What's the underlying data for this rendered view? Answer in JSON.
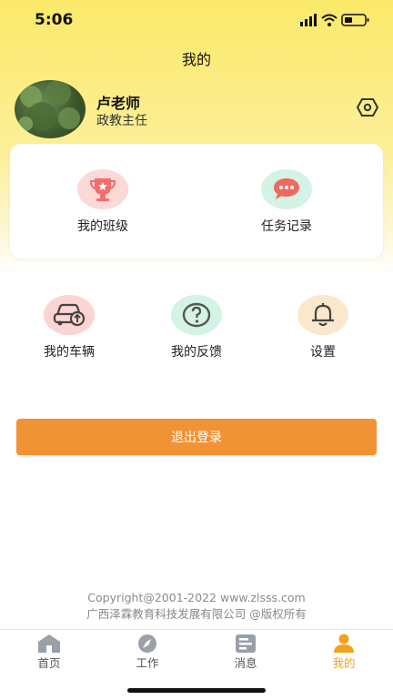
{
  "status_bar": {
    "time": "5:06"
  },
  "header": {
    "title": "我的"
  },
  "profile": {
    "name": "卢老师",
    "role": "政教主任"
  },
  "card": {
    "items": [
      {
        "label": "我的班级",
        "icon": "trophy-icon"
      },
      {
        "label": "任务记录",
        "icon": "chat-bubble-icon"
      }
    ]
  },
  "grid": {
    "items": [
      {
        "label": "我的车辆",
        "icon": "car-icon"
      },
      {
        "label": "我的反馈",
        "icon": "question-icon"
      },
      {
        "label": "设置",
        "icon": "bell-icon"
      }
    ]
  },
  "logout": {
    "label": "退出登录"
  },
  "footer": {
    "line1": "Copyright@2001-2022 www.zlsss.com",
    "line2": "广西泽霖教育科技发展有限公司 @版权所有"
  },
  "tabbar": {
    "items": [
      {
        "label": "首页",
        "icon": "home-icon"
      },
      {
        "label": "工作",
        "icon": "compass-icon"
      },
      {
        "label": "消息",
        "icon": "message-icon"
      },
      {
        "label": "我的",
        "icon": "person-icon"
      }
    ],
    "active_index": 3
  },
  "colors": {
    "accent": "#f09335",
    "active_tab": "#f3a21c",
    "header_yellow": "#fbe96a"
  }
}
